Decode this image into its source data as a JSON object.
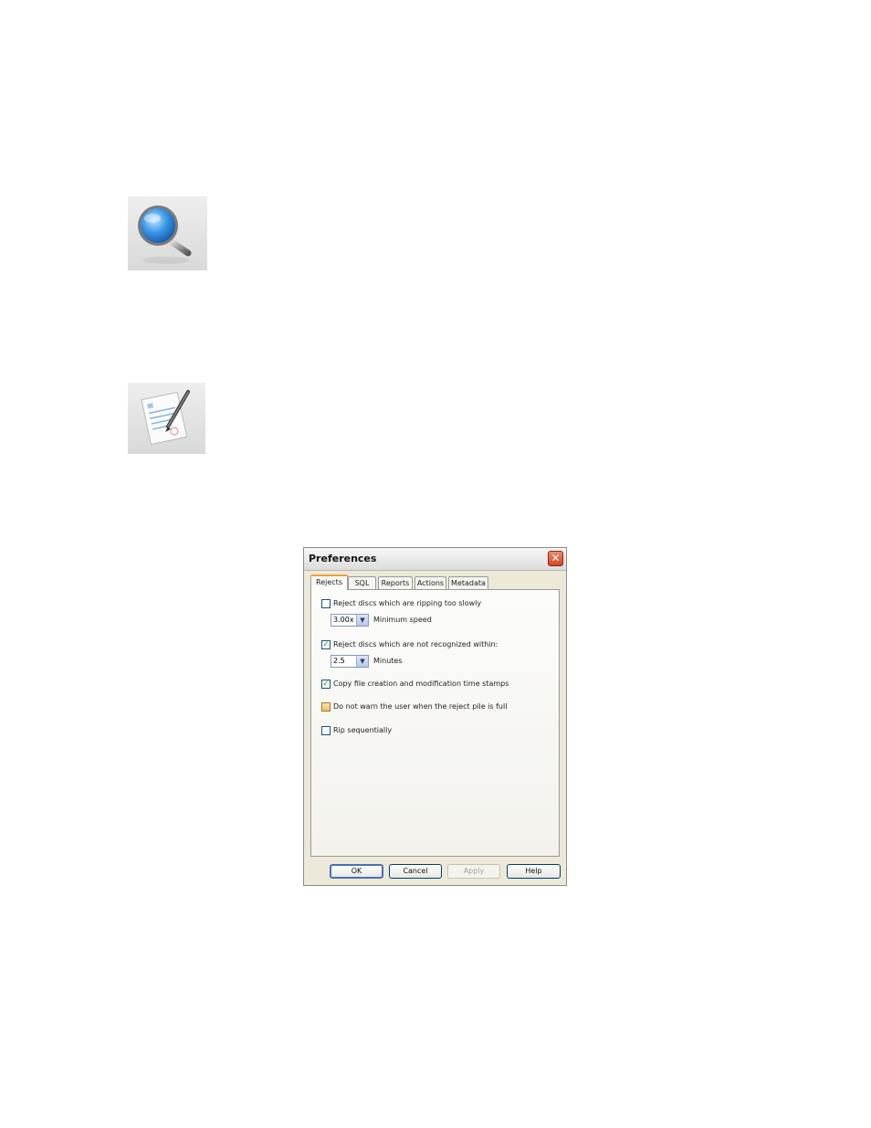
{
  "icons": {
    "search": "magnifier-icon",
    "document": "document-pen-icon"
  },
  "dialog": {
    "title": "Preferences",
    "close_glyph": "✕",
    "tabs": [
      "Rejects",
      "SQL",
      "Reports",
      "Actions",
      "Metadata"
    ],
    "active_tab": "Rejects",
    "options": {
      "reject_slow": {
        "label": "Reject discs which are ripping too slowly",
        "checked": false
      },
      "min_speed": {
        "value": "3.00x",
        "label": "Minimum speed"
      },
      "reject_unrecognized": {
        "label": "Reject discs which are not recognized within:",
        "checked": true
      },
      "minutes": {
        "value": "2.5",
        "label": "Minutes"
      },
      "copy_timestamps": {
        "label": "Copy file creation and modification time stamps",
        "checked": true
      },
      "no_warn": {
        "label": "Do not warn the user when the reject pile is full",
        "checked": false
      },
      "rip_seq": {
        "label": "Rip sequentially",
        "checked": false
      }
    },
    "buttons": {
      "ok": "OK",
      "cancel": "Cancel",
      "apply": "Apply",
      "help": "Help"
    }
  }
}
